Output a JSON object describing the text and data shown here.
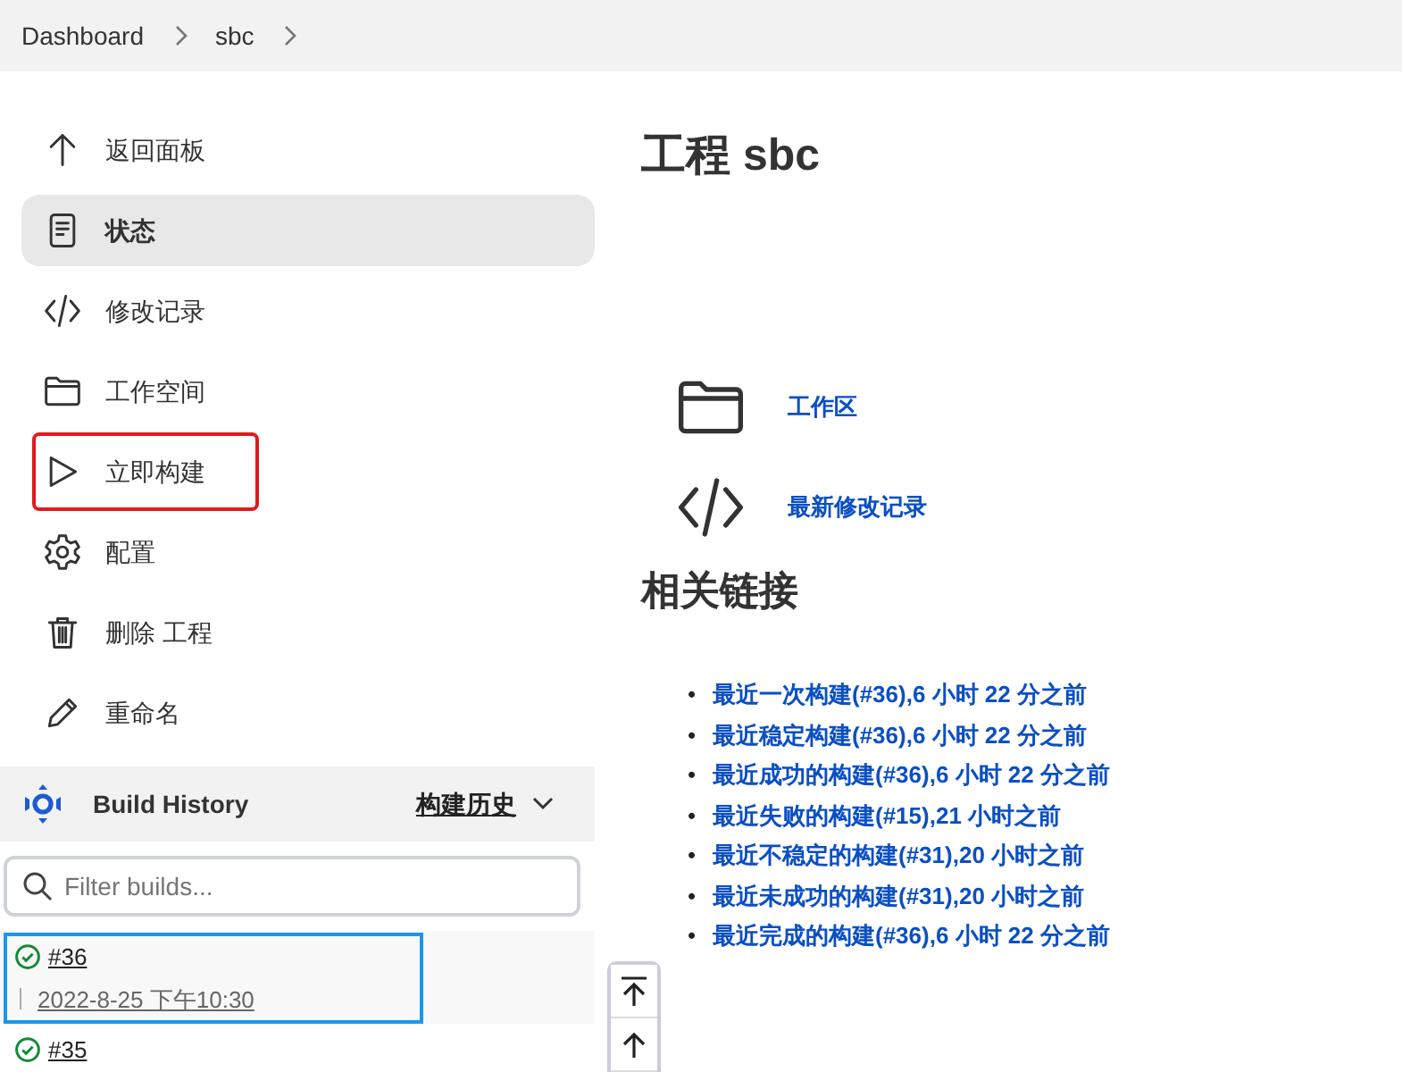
{
  "breadcrumb": [
    "Dashboard",
    "sbc"
  ],
  "sidebar": {
    "items": [
      {
        "label": "返回面板",
        "selected": false,
        "highlighted": false
      },
      {
        "label": "状态",
        "selected": true,
        "highlighted": false
      },
      {
        "label": "修改记录",
        "selected": false,
        "highlighted": false
      },
      {
        "label": "工作空间",
        "selected": false,
        "highlighted": false
      },
      {
        "label": "立即构建",
        "selected": false,
        "highlighted": true
      },
      {
        "label": "配置",
        "selected": false,
        "highlighted": false
      },
      {
        "label": "删除 工程",
        "selected": false,
        "highlighted": false
      },
      {
        "label": "重命名",
        "selected": false,
        "highlighted": false
      }
    ]
  },
  "build_history": {
    "title": "Build History",
    "link": "构建历史",
    "filter": {
      "placeholder": "Filter builds..."
    },
    "builds": [
      {
        "number": "#36",
        "time": "2022-8-25 下午10:30",
        "selected": true
      },
      {
        "number": "#35",
        "selected": false
      }
    ]
  },
  "main": {
    "title": "工程 sbc",
    "shortcuts": [
      {
        "label": "工作区"
      },
      {
        "label": "最新修改记录"
      }
    ],
    "related_heading": "相关链接",
    "links": [
      {
        "bullet": "•",
        "text": "最近一次构建(#36),6 小时 22 分之前"
      },
      {
        "bullet": "•",
        "text": "最近稳定构建(#36),6 小时 22 分之前"
      },
      {
        "bullet": "•",
        "text": "最近成功的构建(#36),6 小时 22 分之前"
      },
      {
        "bullet": "•",
        "text": "最近失败的构建(#15),21 小时之前"
      },
      {
        "bullet": "•",
        "text": "最近不稳定的构建(#31),20 小时之前"
      },
      {
        "bullet": "•",
        "text": "最近未成功的构建(#31),20 小时之前"
      },
      {
        "bullet": "•",
        "text": "最近完成的构建(#36),6 小时 22 分之前"
      }
    ]
  }
}
